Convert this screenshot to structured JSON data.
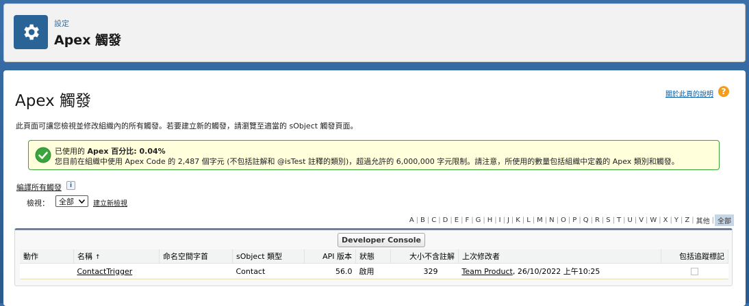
{
  "header": {
    "breadcrumb": "設定",
    "title": "Apex 觸發",
    "icon": "gear-icon",
    "icon_color": "#2a6496"
  },
  "main": {
    "title": "Apex 觸發",
    "help_link": "關於此頁的說明",
    "description": "此頁面可讓您檢視並修改組織內的所有觸發。若要建立新的觸發，請瀏覽至適當的 sObject 觸發頁面。",
    "info": {
      "line1_prefix": "已使用的 ",
      "line1_bold": "Apex 百分比: 0.04%",
      "line2": "您目前在組織中使用 Apex Code 的 2,487 個字元 (不包括註解和 @isTest 註釋的類別)，超過允許的 6,000,000 字元限制。請注意，所使用的數量包括組織中定義的 Apex 類別和觸發。",
      "status_color": "#39a339"
    },
    "edit_all": "編譯所有觸發",
    "info_icon": "i",
    "view_label": "檢視：",
    "view_selected": "全部",
    "new_view": "建立新檢視",
    "alpha": [
      "A",
      "B",
      "C",
      "D",
      "E",
      "F",
      "G",
      "H",
      "I",
      "J",
      "K",
      "L",
      "M",
      "N",
      "O",
      "P",
      "Q",
      "R",
      "S",
      "T",
      "U",
      "V",
      "W",
      "X",
      "Y",
      "Z",
      "其他",
      "全部"
    ],
    "alpha_selected": "全部",
    "developer_console": "Developer Console",
    "columns": {
      "action": "動作",
      "name": "名稱",
      "name_sort": "↑",
      "namespace": "命名空間字首",
      "sobject": "sObject 類型",
      "api": "API 版本",
      "status": "狀態",
      "size": "大小不含註解",
      "modified": "上次修改者",
      "trace": "包括追蹤標記"
    },
    "rows": [
      {
        "action": "",
        "name": "ContactTrigger",
        "namespace": "",
        "sobject": "Contact",
        "api": "56.0",
        "status": "啟用",
        "size": "329",
        "modified_by": "Team Product",
        "modified_at": ", 26/10/2022 上午10:25",
        "trace": false
      }
    ]
  }
}
